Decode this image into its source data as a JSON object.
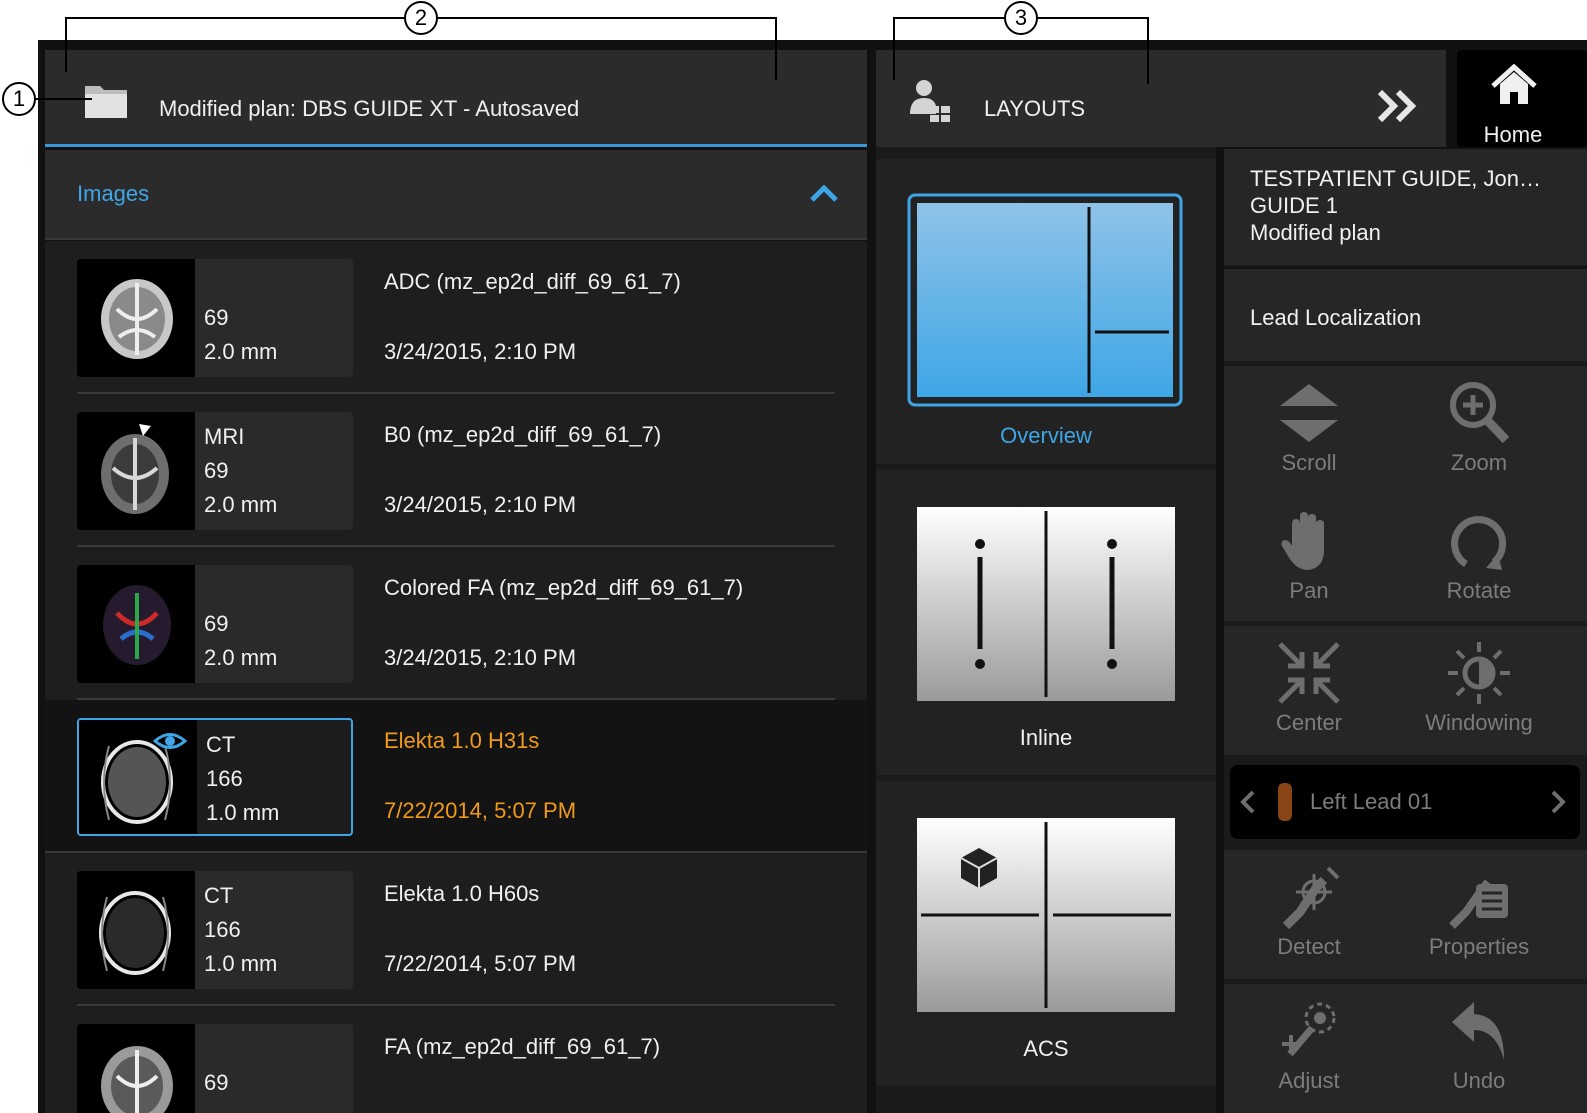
{
  "callouts": [
    "1",
    "2",
    "3"
  ],
  "plan": {
    "title": "Modified plan: DBS GUIDE XT - Autosaved"
  },
  "images": {
    "label": "Images",
    "rows": [
      {
        "modality": "",
        "slices": "69",
        "thickness": "2.0 mm",
        "name": "ADC (mz_ep2d_diff_69_61_7)",
        "date": "3/24/2015, 2:10 PM",
        "selected": false
      },
      {
        "modality": "MRI",
        "slices": "69",
        "thickness": "2.0 mm",
        "name": "B0 (mz_ep2d_diff_69_61_7)",
        "date": "3/24/2015, 2:10 PM",
        "selected": false
      },
      {
        "modality": "",
        "slices": "69",
        "thickness": "2.0 mm",
        "name": "Colored FA (mz_ep2d_diff_69_61_7)",
        "date": "3/24/2015, 2:10 PM",
        "selected": false
      },
      {
        "modality": "CT",
        "slices": "166",
        "thickness": "1.0 mm",
        "name": "Elekta 1.0 H31s",
        "date": "7/22/2014, 5:07 PM",
        "selected": true
      },
      {
        "modality": "CT",
        "slices": "166",
        "thickness": "1.0 mm",
        "name": "Elekta 1.0 H60s",
        "date": "7/22/2014, 5:07 PM",
        "selected": false
      },
      {
        "modality": "",
        "slices": "69",
        "thickness": "",
        "name": "FA (mz_ep2d_diff_69_61_7)",
        "date": "",
        "selected": false
      }
    ]
  },
  "layouts": {
    "title": "LAYOUTS",
    "items": [
      {
        "label": "Overview",
        "active": true
      },
      {
        "label": "Inline",
        "active": false
      },
      {
        "label": "ACS",
        "active": false
      }
    ]
  },
  "home": {
    "label": "Home"
  },
  "patient": {
    "name": "TESTPATIENT GUIDE, Jon…",
    "id": "GUIDE 1",
    "plan": "Modified plan"
  },
  "workflow": {
    "step": "Lead Localization"
  },
  "tools": {
    "scroll": "Scroll",
    "zoom": "Zoom",
    "pan": "Pan",
    "rotate": "Rotate",
    "center": "Center",
    "windowing": "Windowing",
    "detect": "Detect",
    "properties": "Properties",
    "adjust": "Adjust",
    "undo": "Undo"
  },
  "lead": {
    "label": "Left Lead 01",
    "color": "#8a4516"
  },
  "colors": {
    "accent": "#3ea6e6",
    "selected_text": "#f09a1a",
    "disabled": "#7c7c7c"
  }
}
